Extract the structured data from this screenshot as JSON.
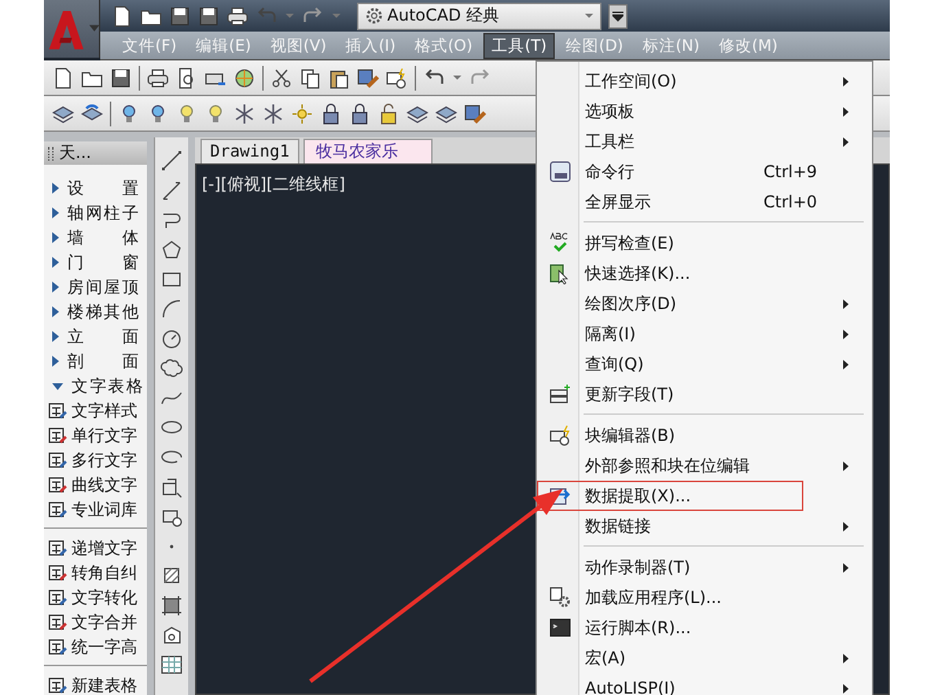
{
  "workspace_dropdown": {
    "value": "AutoCAD 经典"
  },
  "menu_bar": [
    {
      "label": "文件(F)",
      "selected": false
    },
    {
      "label": "编辑(E)",
      "selected": false
    },
    {
      "label": "视图(V)",
      "selected": false
    },
    {
      "label": "插入(I)",
      "selected": false
    },
    {
      "label": "格式(O)",
      "selected": false
    },
    {
      "label": "工具(T)",
      "selected": true
    },
    {
      "label": "绘图(D)",
      "selected": false
    },
    {
      "label": "标注(N)",
      "selected": false
    },
    {
      "label": "修改(M)",
      "selected": false
    }
  ],
  "side_panel": {
    "title": "天...",
    "categories": [
      {
        "label": "设 置",
        "expanded": false
      },
      {
        "label": "轴网柱子",
        "expanded": false
      },
      {
        "label": "墙 体",
        "expanded": false
      },
      {
        "label": "门 窗",
        "expanded": false
      },
      {
        "label": "房间屋顶",
        "expanded": false
      },
      {
        "label": "楼梯其他",
        "expanded": false
      },
      {
        "label": "立 面",
        "expanded": false
      },
      {
        "label": "剖 面",
        "expanded": false
      },
      {
        "label": "文字表格",
        "expanded": true
      }
    ],
    "tools": [
      {
        "kind": "tool",
        "label": "文字样式"
      },
      {
        "kind": "tool",
        "label": "单行文字"
      },
      {
        "kind": "tool",
        "label": "多行文字"
      },
      {
        "kind": "tool",
        "label": "曲线文字"
      },
      {
        "kind": "tool",
        "label": "专业词库"
      },
      {
        "kind": "separator"
      },
      {
        "kind": "tool",
        "label": "递增文字"
      },
      {
        "kind": "tool",
        "label": "转角自纠"
      },
      {
        "kind": "tool",
        "label": "文字转化"
      },
      {
        "kind": "tool",
        "label": "文字合并"
      },
      {
        "kind": "tool",
        "label": "统一字高"
      },
      {
        "kind": "separator"
      },
      {
        "kind": "tool",
        "label": "新建表格"
      }
    ]
  },
  "tabs": [
    {
      "label": "Drawing1",
      "selected": false
    },
    {
      "label": "牧马农家乐",
      "selected": true
    }
  ],
  "viewport_label": "[-][俯视][二维线框]",
  "tools_menu": [
    {
      "kind": "item",
      "label": "工作空间(O)",
      "submenu": true,
      "boxed": false
    },
    {
      "kind": "item",
      "label": "选项板",
      "submenu": true,
      "boxed": false
    },
    {
      "kind": "item",
      "label": "工具栏",
      "submenu": true,
      "boxed": false
    },
    {
      "kind": "item",
      "label": "命令行",
      "shortcut": "Ctrl+9",
      "submenu": false,
      "boxed": false
    },
    {
      "kind": "item",
      "label": "全屏显示",
      "shortcut": "Ctrl+0",
      "submenu": false,
      "boxed": false
    },
    {
      "kind": "separator"
    },
    {
      "kind": "item",
      "label": "拼写检查(E)",
      "submenu": false,
      "boxed": false
    },
    {
      "kind": "item",
      "label": "快速选择(K)...",
      "submenu": false,
      "boxed": false
    },
    {
      "kind": "item",
      "label": "绘图次序(D)",
      "submenu": true,
      "boxed": false
    },
    {
      "kind": "item",
      "label": "隔离(I)",
      "submenu": true,
      "boxed": false
    },
    {
      "kind": "item",
      "label": "查询(Q)",
      "submenu": true,
      "boxed": false
    },
    {
      "kind": "item",
      "label": "更新字段(T)",
      "submenu": false,
      "boxed": false
    },
    {
      "kind": "separator"
    },
    {
      "kind": "item",
      "label": "块编辑器(B)",
      "submenu": false,
      "boxed": false
    },
    {
      "kind": "item",
      "label": "外部参照和块在位编辑",
      "submenu": true,
      "boxed": false
    },
    {
      "kind": "item",
      "label": "数据提取(X)...",
      "submenu": false,
      "boxed": true
    },
    {
      "kind": "item",
      "label": "数据链接",
      "submenu": true,
      "boxed": false
    },
    {
      "kind": "separator"
    },
    {
      "kind": "item",
      "label": "动作录制器(T)",
      "submenu": true,
      "boxed": false
    },
    {
      "kind": "item",
      "label": "加载应用程序(L)...",
      "submenu": false,
      "boxed": false
    },
    {
      "kind": "item",
      "label": "运行脚本(R)...",
      "submenu": false,
      "boxed": false
    },
    {
      "kind": "item",
      "label": "宏(A)",
      "submenu": true,
      "boxed": false
    },
    {
      "kind": "item",
      "label": "AutoLISP(I)",
      "submenu": true,
      "boxed": false
    }
  ]
}
